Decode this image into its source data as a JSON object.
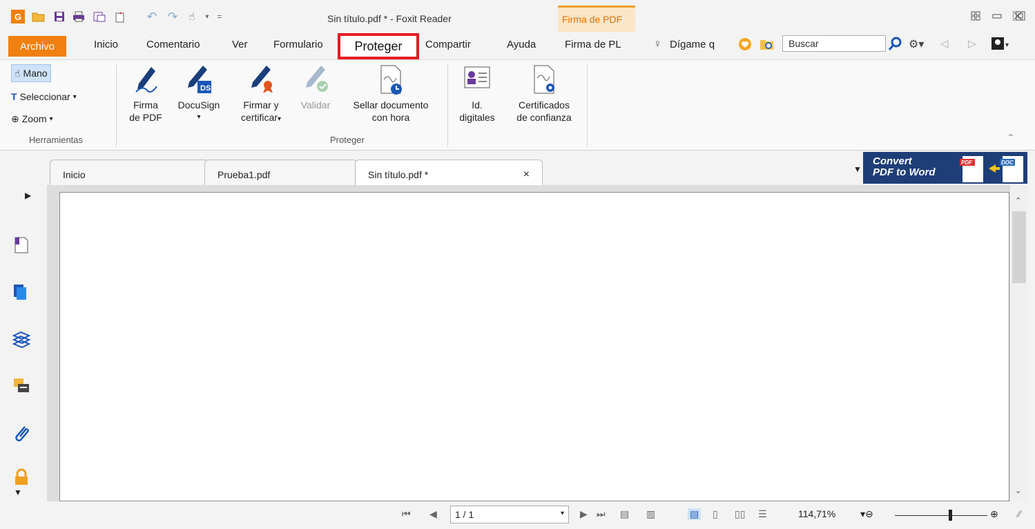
{
  "window": {
    "title": "Sin título.pdf * - Foxit Reader",
    "context_tab": "Firma de PDF",
    "context_tab_color": "#e07000"
  },
  "quick_access": [
    "foxit-logo-icon",
    "open-icon",
    "save-icon",
    "print-icon",
    "print-settings-icon",
    "new-icon",
    "undo-icon",
    "redo-icon",
    "hand-cursor-icon",
    "customize-icon"
  ],
  "menu": {
    "archivo": "Archivo",
    "inicio": "Inicio",
    "comentario": "Comentario",
    "ver": "Ver",
    "formulario": "Formulario",
    "proteger": "Proteger",
    "compartir": "Compartir",
    "ayuda": "Ayuda",
    "firma": "Firma de PL",
    "digame": "Dígame q",
    "search_placeholder": "Buscar",
    "accent": "#f08010",
    "highlight": "#e81a24"
  },
  "ribbon": {
    "tools": {
      "mano": "Mano",
      "seleccionar": "Seleccionar",
      "zoom": "Zoom",
      "group": "Herramientas"
    },
    "proteger": {
      "group": "Proteger",
      "firma_l1": "Firma",
      "firma_l2": "de PDF",
      "docusign": "DocuSign",
      "firmar_l1": "Firmar y",
      "firmar_l2": "certificar",
      "validar": "Validar",
      "sellar_l1": "Sellar documento",
      "sellar_l2": "con hora",
      "id_l1": "Id.",
      "id_l2": "digitales",
      "cert_l1": "Certificados",
      "cert_l2": "de confianza"
    }
  },
  "tabs": {
    "inicio": "Inicio",
    "prueba": "Prueba1.pdf",
    "sin_titulo": "Sin título.pdf *",
    "close": "×"
  },
  "banner": {
    "line1": "Convert",
    "line2": "PDF to Word"
  },
  "status": {
    "page": "1 / 1",
    "zoom": "114,71%"
  }
}
